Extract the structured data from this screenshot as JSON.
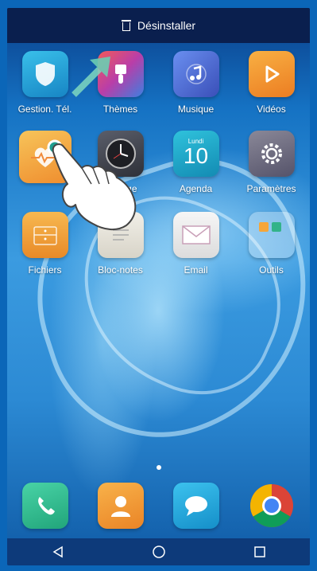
{
  "status_bar": {
    "uninstall_label": "Désinstaller"
  },
  "apps": [
    {
      "label": "Gestion. Tél.",
      "icon": "shield-icon",
      "color": "#1f9fd6"
    },
    {
      "label": "Thèmes",
      "icon": "paintbrush-icon",
      "color": "#e5426a"
    },
    {
      "label": "Musique",
      "icon": "music-note-icon",
      "color": "#3f6fe0"
    },
    {
      "label": "Vidéos",
      "icon": "play-icon",
      "color": "#f0962c"
    },
    {
      "label": "",
      "icon": "health-heart-icon",
      "color": "#f2a23c"
    },
    {
      "label": "Horloge",
      "icon": "clock-icon",
      "color": "#4a4e5a"
    },
    {
      "label": "Agenda",
      "icon": "calendar-icon",
      "color": "#1aa6c7",
      "day_name": "Lundi",
      "day_number": "10"
    },
    {
      "label": "Paramètres",
      "icon": "gear-icon",
      "color": "#6c6a7c"
    },
    {
      "label": "Fichiers",
      "icon": "folder-icon",
      "color": "#f0a040"
    },
    {
      "label": "Bloc-notes",
      "icon": "notepad-icon",
      "color": "#e6e4de"
    },
    {
      "label": "Email",
      "icon": "envelope-icon",
      "color": "#ececec"
    },
    {
      "label": "Outils",
      "icon": "tools-folder-icon",
      "color": "rgba(255,255,255,0.35)"
    }
  ],
  "dock": [
    {
      "icon": "phone-icon",
      "color": "#2ebd8a"
    },
    {
      "icon": "contacts-icon",
      "color": "#f29b2e"
    },
    {
      "icon": "messages-icon",
      "color": "#1aa6d6"
    },
    {
      "icon": "chrome-icon",
      "color": "#ffffff"
    }
  ],
  "nav": {
    "back": "◁",
    "home": "○",
    "recents": "□"
  }
}
